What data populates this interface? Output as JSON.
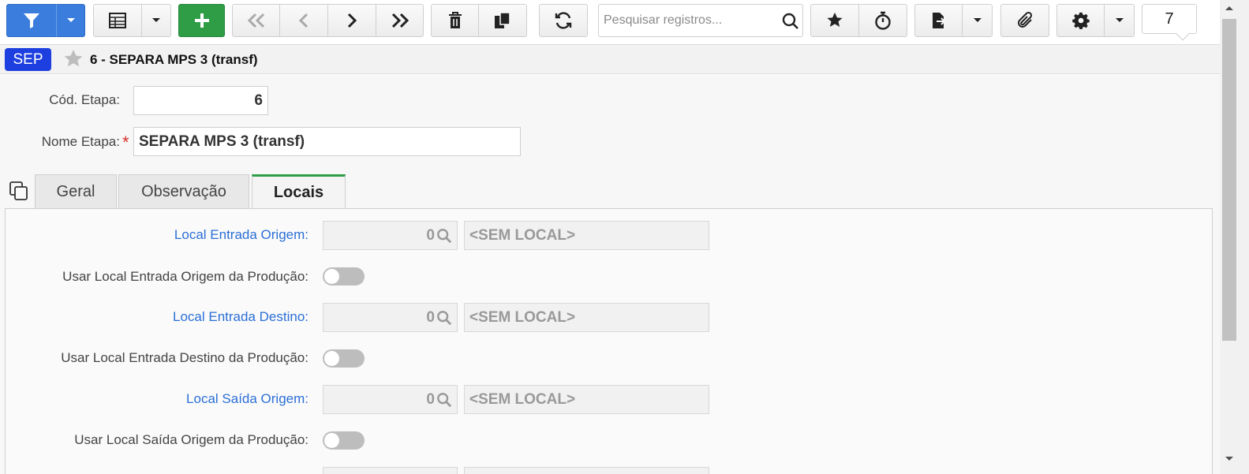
{
  "toolbar": {
    "search_placeholder": "Pesquisar registros...",
    "record_count": "7",
    "accent_blue": "#3b7ddd",
    "accent_green": "#2e9d45"
  },
  "record": {
    "badge": "SEP",
    "title": "6 - SEPARA MPS 3 (transf)"
  },
  "form": {
    "cod_etapa_label": "Cód. Etapa:",
    "cod_etapa_value": "6",
    "nome_etapa_label": "Nome Etapa:",
    "nome_etapa_value": "SEPARA MPS 3 (transf)",
    "required_mark": "*"
  },
  "tabs": [
    {
      "label": "Geral"
    },
    {
      "label": "Observação"
    },
    {
      "label": "Locais"
    }
  ],
  "locais": {
    "entrada_origem_label": "Local Entrada Origem:",
    "entrada_origem_code": "0",
    "entrada_origem_desc": "<SEM LOCAL>",
    "usar_entrada_origem_label": "Usar Local Entrada Origem da Produção:",
    "entrada_destino_label": "Local Entrada Destino:",
    "entrada_destino_code": "0",
    "entrada_destino_desc": "<SEM LOCAL>",
    "usar_entrada_destino_label": "Usar Local Entrada Destino da Produção:",
    "saida_origem_label": "Local Saída Origem:",
    "saida_origem_code": "0",
    "saida_origem_desc": "<SEM LOCAL>",
    "usar_saida_origem_label": "Usar Local Saída Origem da Produção:"
  },
  "icons": [
    "filter-icon",
    "chevron-down-icon",
    "table-icon",
    "plus-icon",
    "first-icon",
    "prev-icon",
    "next-icon",
    "last-icon",
    "trash-icon",
    "copy-icon",
    "refresh-icon",
    "search-icon",
    "star-icon",
    "stopwatch-icon",
    "export-icon",
    "paperclip-icon",
    "gear-icon"
  ]
}
